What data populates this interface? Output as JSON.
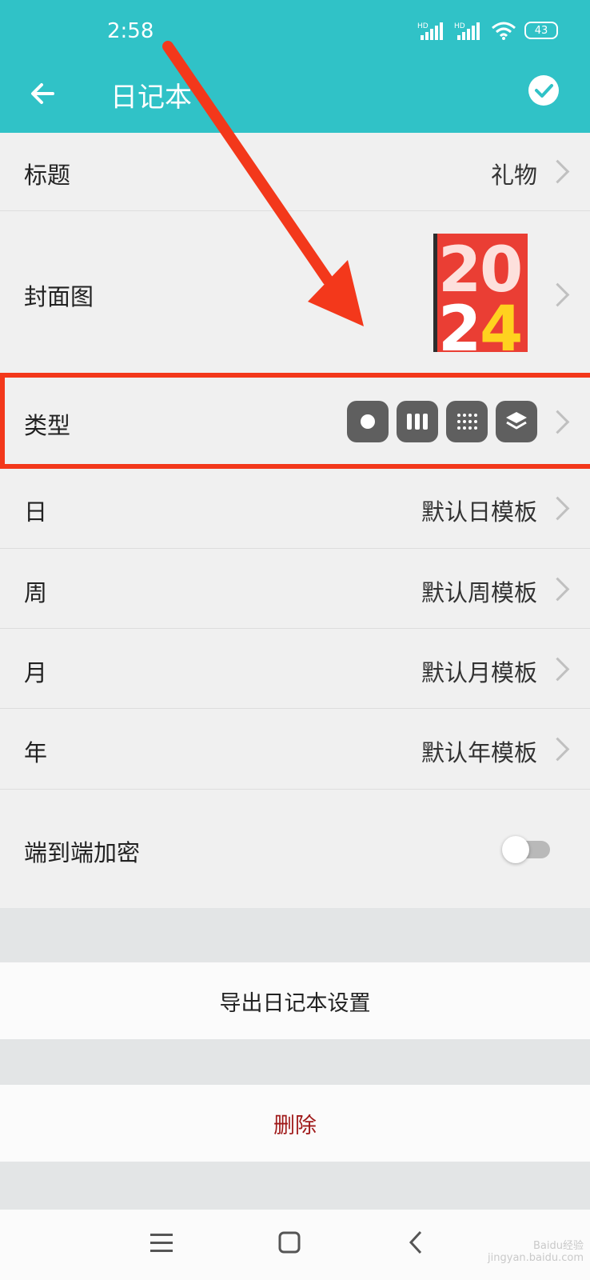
{
  "status": {
    "time": "2:58",
    "battery": "43"
  },
  "appbar": {
    "title": "日记本"
  },
  "rows": {
    "title_label": "标题",
    "title_value": "礼物",
    "cover_label": "封面图",
    "cover_art_text": "2024",
    "type_label": "类型",
    "day_label": "日",
    "day_value": "默认日模板",
    "week_label": "周",
    "week_value": "默认周模板",
    "month_label": "月",
    "month_value": "默认月模板",
    "year_label": "年",
    "year_value": "默认年模板",
    "encrypt_label": "端到端加密"
  },
  "actions": {
    "export": "导出日记本设置",
    "delete": "删除"
  },
  "colors": {
    "header": "#30c2c7",
    "annotation": "#f3381b",
    "delete_text": "#a01a1a"
  },
  "watermark": "Baidu经验 jingyan.baidu.com"
}
